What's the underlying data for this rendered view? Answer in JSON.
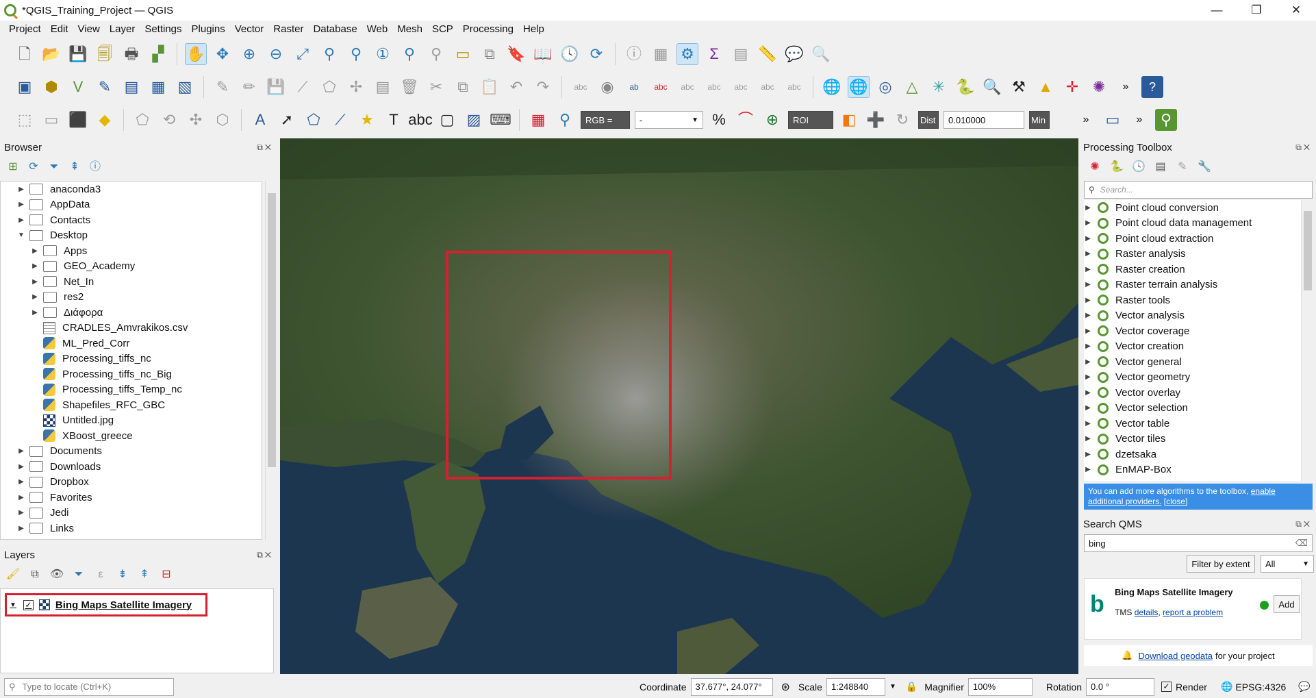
{
  "window": {
    "title": "*QGIS_Training_Project — QGIS",
    "controls": [
      "—",
      "❐",
      "✕"
    ]
  },
  "menu": [
    "Project",
    "Edit",
    "View",
    "Layer",
    "Settings",
    "Plugins",
    "Vector",
    "Raster",
    "Database",
    "Web",
    "Mesh",
    "SCP",
    "Processing",
    "Help"
  ],
  "scp_toolbar": {
    "rgb_label": "RGB =",
    "rgb_value": "-",
    "roi_label": "ROI",
    "dist_label": "Dist",
    "dist_value": "0.010000",
    "min_label": "Min"
  },
  "browser": {
    "title": "Browser",
    "items": [
      {
        "label": "anaconda3",
        "type": "folder",
        "level": 0,
        "arrow": "▶"
      },
      {
        "label": "AppData",
        "type": "folder",
        "level": 0,
        "arrow": "▶"
      },
      {
        "label": "Contacts",
        "type": "folder",
        "level": 0,
        "arrow": "▶"
      },
      {
        "label": "Desktop",
        "type": "folder",
        "level": 0,
        "arrow": "▼"
      },
      {
        "label": "Apps",
        "type": "folder",
        "level": 1,
        "arrow": "▶"
      },
      {
        "label": "GEO_Academy",
        "type": "folder",
        "level": 1,
        "arrow": "▶"
      },
      {
        "label": "Net_In",
        "type": "folder",
        "level": 1,
        "arrow": "▶"
      },
      {
        "label": "res2",
        "type": "folder",
        "level": 1,
        "arrow": "▶"
      },
      {
        "label": "Διάφορα",
        "type": "folder",
        "level": 1,
        "arrow": "▶"
      },
      {
        "label": "CRADLES_Amvrakikos.csv",
        "type": "csv",
        "level": 1,
        "arrow": ""
      },
      {
        "label": "ML_Pred_Corr",
        "type": "py",
        "level": 1,
        "arrow": ""
      },
      {
        "label": "Processing_tiffs_nc",
        "type": "py",
        "level": 1,
        "arrow": ""
      },
      {
        "label": "Processing_tiffs_nc_Big",
        "type": "py",
        "level": 1,
        "arrow": ""
      },
      {
        "label": "Processing_tiffs_Temp_nc",
        "type": "py",
        "level": 1,
        "arrow": ""
      },
      {
        "label": "Shapefiles_RFC_GBC",
        "type": "py",
        "level": 1,
        "arrow": ""
      },
      {
        "label": "Untitled.jpg",
        "type": "raster",
        "level": 1,
        "arrow": ""
      },
      {
        "label": "XBoost_greece",
        "type": "py",
        "level": 1,
        "arrow": ""
      },
      {
        "label": "Documents",
        "type": "folder",
        "level": 0,
        "arrow": "▶"
      },
      {
        "label": "Downloads",
        "type": "folder",
        "level": 0,
        "arrow": "▶"
      },
      {
        "label": "Dropbox",
        "type": "folder",
        "level": 0,
        "arrow": "▶"
      },
      {
        "label": "Favorites",
        "type": "folder",
        "level": 0,
        "arrow": "▶"
      },
      {
        "label": "Jedi",
        "type": "folder",
        "level": 0,
        "arrow": "▶"
      },
      {
        "label": "Links",
        "type": "folder",
        "level": 0,
        "arrow": "▶"
      }
    ]
  },
  "layers": {
    "title": "Layers",
    "items": [
      {
        "label": "Bing Maps Satellite Imagery",
        "checked": "✓"
      }
    ]
  },
  "toolbox": {
    "title": "Processing Toolbox",
    "search_placeholder": "Search...",
    "items": [
      "Point cloud conversion",
      "Point cloud data management",
      "Point cloud extraction",
      "Raster analysis",
      "Raster creation",
      "Raster terrain analysis",
      "Raster tools",
      "Vector analysis",
      "Vector coverage",
      "Vector creation",
      "Vector general",
      "Vector geometry",
      "Vector overlay",
      "Vector selection",
      "Vector table",
      "Vector tiles",
      "dzetsaka",
      "EnMAP-Box"
    ],
    "info_text": "You can add more algorithms to the toolbox,",
    "info_link": "enable additional providers.",
    "info_close": "[close]"
  },
  "qms": {
    "title": "Search QMS",
    "query": "bing",
    "filter_button": "Filter by extent",
    "filter_select": "All",
    "result_title": "Bing Maps Satellite Imagery",
    "result_type": "TMS",
    "details_link": "details",
    "report_link": "report a problem",
    "add_button": "Add",
    "status_color": "#1aa01a",
    "download_link": "Download geodata",
    "download_suffix": "for your project"
  },
  "status": {
    "locate_placeholder": "Type to locate (Ctrl+K)",
    "coordinate_label": "Coordinate",
    "coordinate_value": "37.677°, 24.077°",
    "scale_label": "Scale",
    "scale_value": "1:248840",
    "magnifier_label": "Magnifier",
    "magnifier_value": "100%",
    "rotation_label": "Rotation",
    "rotation_value": "0.0 °",
    "render_label": "Render",
    "crs": "EPSG:4326"
  },
  "colors": {
    "highlight_red": "#d62030",
    "qgis_green": "#589632",
    "info_blue": "#3a8ee6"
  }
}
